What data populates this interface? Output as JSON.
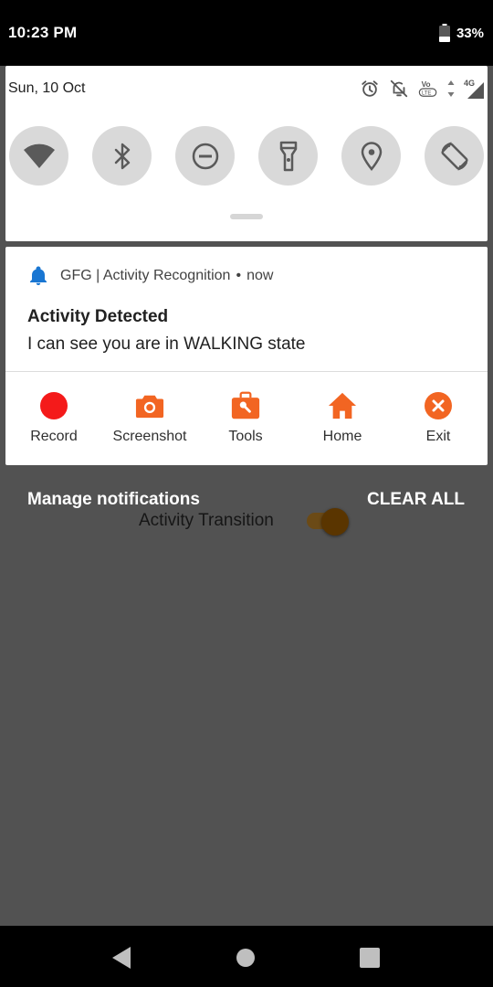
{
  "status_bar": {
    "time": "10:23 PM",
    "battery_percent": "33%",
    "battery_level": 0.33,
    "icons": [
      "battery-icon"
    ]
  },
  "quick_settings": {
    "date": "Sun, 10 Oct",
    "status_icons": [
      "alarm-icon",
      "do-not-disturb-off-icon",
      "volte-icon",
      "data-arrows-icon",
      "signal-4g-icon"
    ],
    "network_label": "4G",
    "volte_label": "Vo",
    "lte_label": "LTE",
    "tiles": [
      "wifi",
      "bluetooth",
      "do-not-disturb",
      "flashlight",
      "location",
      "auto-rotate"
    ]
  },
  "notification": {
    "app_name": "GFG | Activity Recognition",
    "separator": "•",
    "time": "now",
    "title": "Activity Detected",
    "body": "I can see you are in WALKING state",
    "actions": [
      {
        "label": "Record",
        "icon": "record-icon",
        "color": "#f41a1a"
      },
      {
        "label": "Screenshot",
        "icon": "camera-icon",
        "color": "#f26522"
      },
      {
        "label": "Tools",
        "icon": "toolbox-icon",
        "color": "#f26522"
      },
      {
        "label": "Home",
        "icon": "home-icon",
        "color": "#f26522"
      },
      {
        "label": "Exit",
        "icon": "cancel-icon",
        "color": "#f26522"
      }
    ],
    "accent_color": "#1976d2"
  },
  "footer": {
    "manage_label": "Manage notifications",
    "clear_all_label": "CLEAR ALL"
  },
  "app_content": {
    "switch_label": "Activity Transition",
    "switch_on": true
  },
  "nav_bar": {
    "buttons": [
      "back-icon",
      "home-nav-icon",
      "recents-icon"
    ]
  },
  "colors": {
    "scrim": "#525252",
    "panel": "#ffffff",
    "tile": "#d9d9d9",
    "action_orange": "#f26522",
    "record_red": "#f41a1a"
  }
}
